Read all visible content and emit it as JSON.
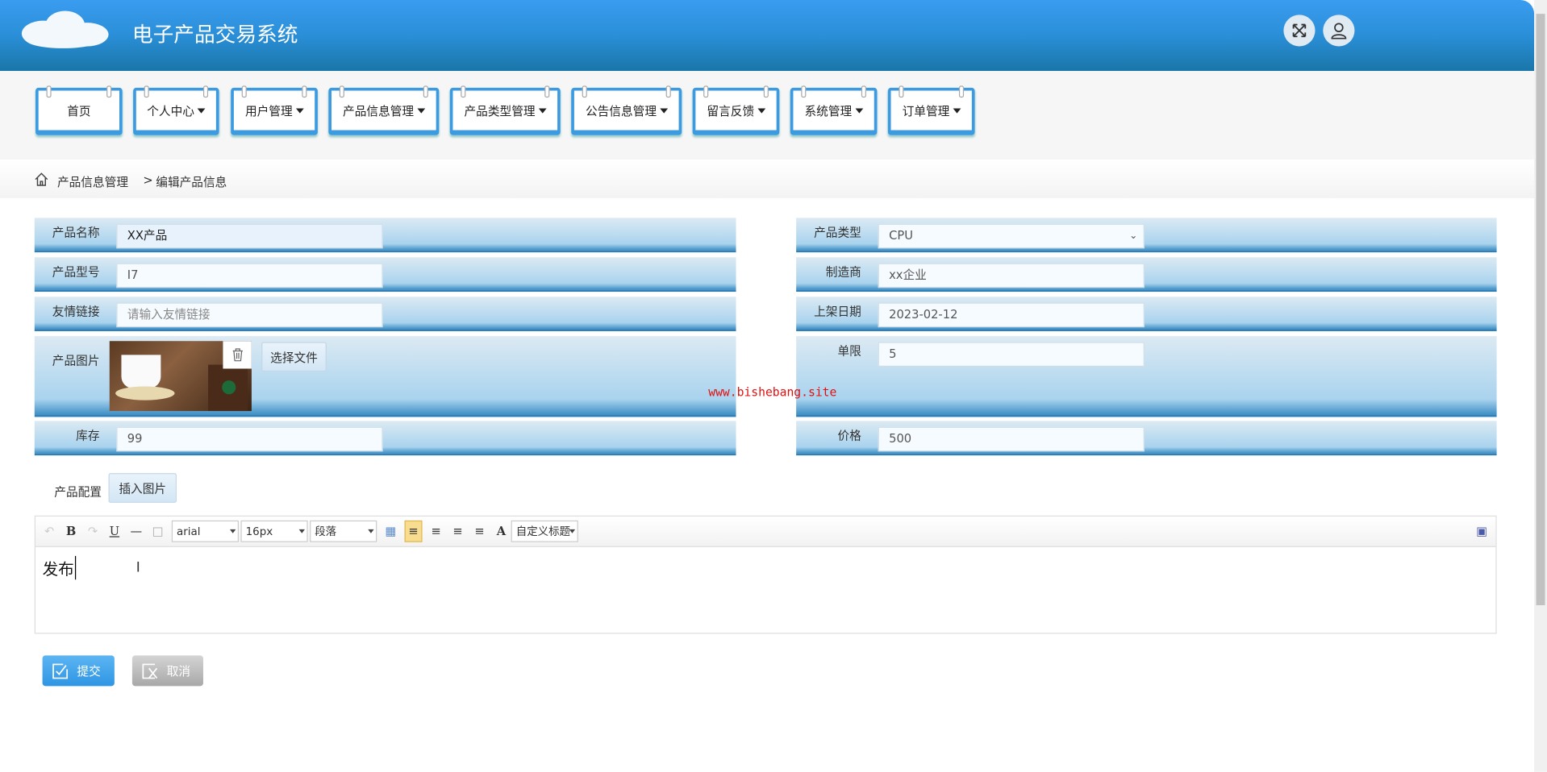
{
  "header": {
    "title": "电子产品交易系统",
    "icons": [
      "fullscreen-icon",
      "user-icon"
    ]
  },
  "nav": [
    {
      "label": "首页",
      "dropdown": false
    },
    {
      "label": "个人中心",
      "dropdown": true
    },
    {
      "label": "用户管理",
      "dropdown": true
    },
    {
      "label": "产品信息管理",
      "dropdown": true
    },
    {
      "label": "产品类型管理",
      "dropdown": true
    },
    {
      "label": "公告信息管理",
      "dropdown": true
    },
    {
      "label": "留言反馈",
      "dropdown": true
    },
    {
      "label": "系统管理",
      "dropdown": true
    },
    {
      "label": "订单管理",
      "dropdown": true
    }
  ],
  "breadcrumb": {
    "parent": "产品信息管理",
    "separator": ">",
    "current": "编辑产品信息"
  },
  "form": {
    "name": {
      "label": "产品名称",
      "value": "XX产品"
    },
    "type": {
      "label": "产品类型",
      "value": "CPU"
    },
    "model": {
      "label": "产品型号",
      "value": "I7"
    },
    "maker": {
      "label": "制造商",
      "value": "xx企业"
    },
    "link": {
      "label": "友情链接",
      "placeholder": "请输入友情链接"
    },
    "date": {
      "label": "上架日期",
      "value": "2023-02-12"
    },
    "image": {
      "label": "产品图片",
      "choose": "选择文件"
    },
    "limit": {
      "label": "单限",
      "value": "5"
    },
    "stock": {
      "label": "库存",
      "value": "99"
    },
    "price": {
      "label": "价格",
      "value": "500"
    },
    "config": {
      "label": "产品配置",
      "insert": "插入图片"
    }
  },
  "editor": {
    "font": "arial",
    "size": "16px",
    "paragraph": "段落",
    "heading": "自定义标题",
    "content": "发布"
  },
  "actions": {
    "submit": "提交",
    "cancel": "取消"
  },
  "watermark": "www.bishebang.site"
}
